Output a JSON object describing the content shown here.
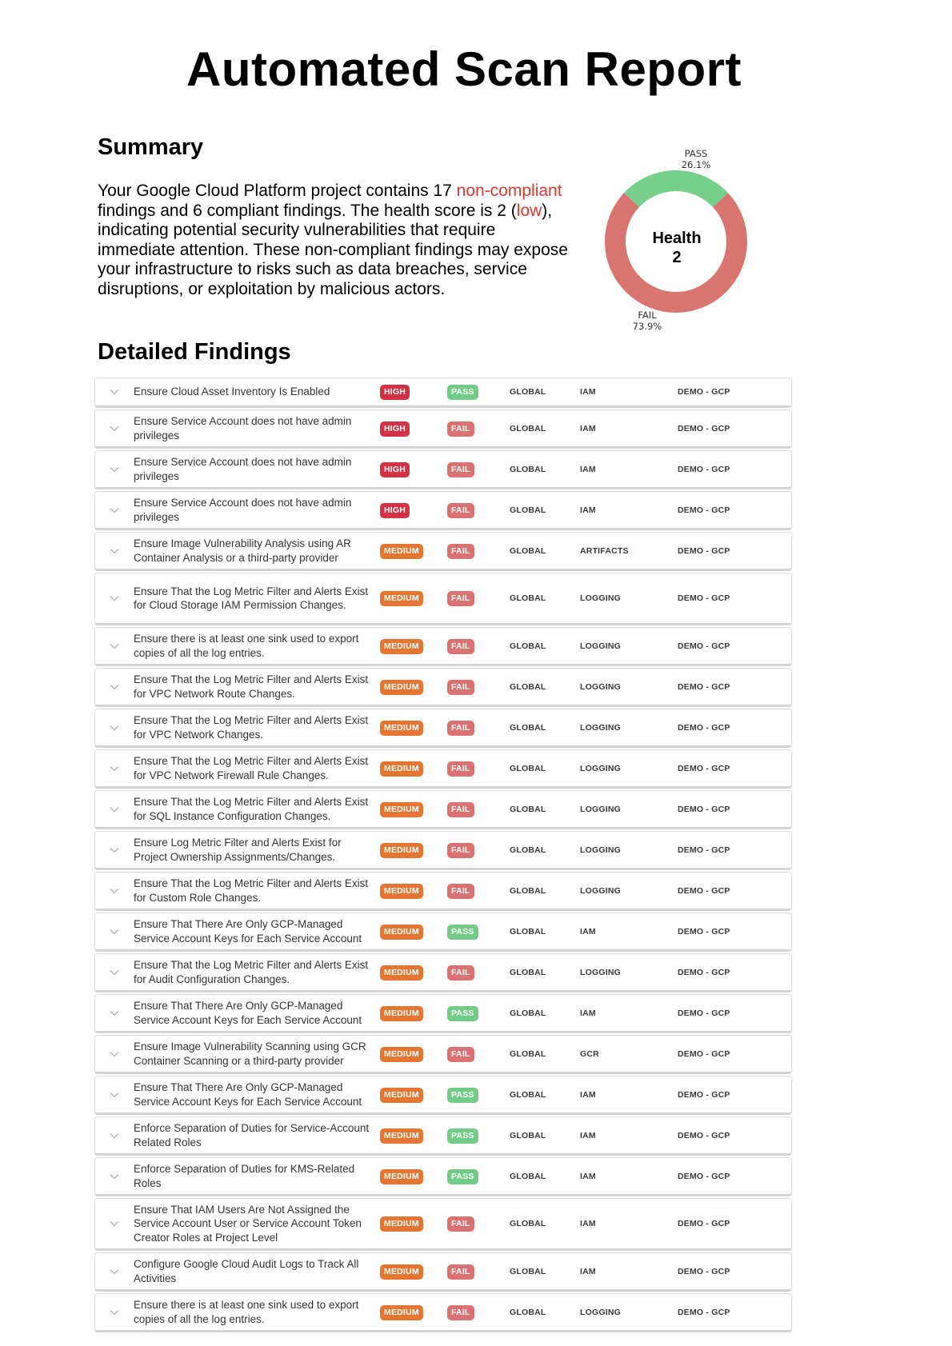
{
  "report": {
    "title": "Automated Scan Report"
  },
  "summary": {
    "heading": "Summary",
    "text_parts": [
      "Your Google Cloud Platform project contains 17 ",
      "non-compliant",
      " findings and 6 compliant findings. The health score is 2 (",
      "low",
      "), indicating potential security vulnerabilities that require immediate attention. These non-compliant findings may expose your infrastructure to risks such as data breaches, service disruptions, or exploitation by malicious actors."
    ],
    "non_compliant_count": 17,
    "compliant_count": 6,
    "health_score": 2,
    "health_rating": "low"
  },
  "chart_data": {
    "type": "pie",
    "donut": true,
    "center_label": [
      "Health",
      "2"
    ],
    "slices": [
      {
        "label": "PASS",
        "value": 26.1,
        "display": "26.1%",
        "color": "#76cf8b"
      },
      {
        "label": "FAIL",
        "value": 73.9,
        "display": "73.9%",
        "color": "#d97570"
      }
    ]
  },
  "findings": {
    "heading": "Detailed Findings",
    "colors": {
      "HIGH": "#d33144",
      "MEDIUM": "#e47632",
      "PASS": "#72cc88",
      "FAIL": "#da7272"
    },
    "rows": [
      {
        "title": "Ensure Cloud Asset Inventory Is Enabled",
        "severity": "HIGH",
        "status": "PASS",
        "region": "GLOBAL",
        "service": "IAM",
        "project": "DEMO - GCP",
        "lines": 1
      },
      {
        "title": "Ensure Service Account does not have admin privileges",
        "severity": "HIGH",
        "status": "FAIL",
        "region": "GLOBAL",
        "service": "IAM",
        "project": "DEMO - GCP",
        "lines": 2
      },
      {
        "title": "Ensure Service Account does not have admin privileges",
        "severity": "HIGH",
        "status": "FAIL",
        "region": "GLOBAL",
        "service": "IAM",
        "project": "DEMO - GCP",
        "lines": 2
      },
      {
        "title": "Ensure Service Account does not have admin privileges",
        "severity": "HIGH",
        "status": "FAIL",
        "region": "GLOBAL",
        "service": "IAM",
        "project": "DEMO - GCP",
        "lines": 2
      },
      {
        "title": "Ensure Image Vulnerability Analysis using AR Container Analysis or a third-party provider",
        "severity": "MEDIUM",
        "status": "FAIL",
        "region": "GLOBAL",
        "service": "ARTIFACTS",
        "project": "DEMO - GCP",
        "lines": 2
      },
      {
        "title": "Ensure That the Log Metric Filter and Alerts Exist for Cloud Storage IAM Permission Changes.",
        "severity": "MEDIUM",
        "status": "FAIL",
        "region": "GLOBAL",
        "service": "LOGGING",
        "project": "DEMO - GCP",
        "lines": 3
      },
      {
        "title": "Ensure there is at least one sink used to export copies of all the log entries.",
        "severity": "MEDIUM",
        "status": "FAIL",
        "region": "GLOBAL",
        "service": "LOGGING",
        "project": "DEMO - GCP",
        "lines": 2
      },
      {
        "title": "Ensure That the Log Metric Filter and Alerts Exist for VPC Network Route Changes.",
        "severity": "MEDIUM",
        "status": "FAIL",
        "region": "GLOBAL",
        "service": "LOGGING",
        "project": "DEMO - GCP",
        "lines": 2
      },
      {
        "title": "Ensure That the Log Metric Filter and Alerts Exist for VPC Network Changes.",
        "severity": "MEDIUM",
        "status": "FAIL",
        "region": "GLOBAL",
        "service": "LOGGING",
        "project": "DEMO - GCP",
        "lines": 2
      },
      {
        "title": "Ensure That the Log Metric Filter and Alerts Exist for VPC Network Firewall Rule Changes.",
        "severity": "MEDIUM",
        "status": "FAIL",
        "region": "GLOBAL",
        "service": "LOGGING",
        "project": "DEMO - GCP",
        "lines": 2
      },
      {
        "title": "Ensure That the Log Metric Filter and Alerts Exist for SQL Instance Configuration Changes.",
        "severity": "MEDIUM",
        "status": "FAIL",
        "region": "GLOBAL",
        "service": "LOGGING",
        "project": "DEMO - GCP",
        "lines": 2
      },
      {
        "title": "Ensure Log Metric Filter and Alerts Exist for Project Ownership Assignments/Changes.",
        "severity": "MEDIUM",
        "status": "FAIL",
        "region": "GLOBAL",
        "service": "LOGGING",
        "project": "DEMO - GCP",
        "lines": 2
      },
      {
        "title": "Ensure That the Log Metric Filter and Alerts Exist for Custom Role Changes.",
        "severity": "MEDIUM",
        "status": "FAIL",
        "region": "GLOBAL",
        "service": "LOGGING",
        "project": "DEMO - GCP",
        "lines": 2
      },
      {
        "title": "Ensure That There Are Only GCP-Managed Service Account Keys for Each Service Account",
        "severity": "MEDIUM",
        "status": "PASS",
        "region": "GLOBAL",
        "service": "IAM",
        "project": "DEMO - GCP",
        "lines": 2
      },
      {
        "title": "Ensure That the Log Metric Filter and Alerts Exist for Audit Configuration Changes.",
        "severity": "MEDIUM",
        "status": "FAIL",
        "region": "GLOBAL",
        "service": "LOGGING",
        "project": "DEMO - GCP",
        "lines": 2
      },
      {
        "title": "Ensure That There Are Only GCP-Managed Service Account Keys for Each Service Account",
        "severity": "MEDIUM",
        "status": "PASS",
        "region": "GLOBAL",
        "service": "IAM",
        "project": "DEMO - GCP",
        "lines": 2
      },
      {
        "title": "Ensure Image Vulnerability Scanning using GCR Container Scanning or a third-party provider",
        "severity": "MEDIUM",
        "status": "FAIL",
        "region": "GLOBAL",
        "service": "GCR",
        "project": "DEMO - GCP",
        "lines": 2
      },
      {
        "title": "Ensure That There Are Only GCP-Managed Service Account Keys for Each Service Account",
        "severity": "MEDIUM",
        "status": "PASS",
        "region": "GLOBAL",
        "service": "IAM",
        "project": "DEMO - GCP",
        "lines": 2
      },
      {
        "title": "Enforce Separation of Duties for Service-Account Related Roles",
        "severity": "MEDIUM",
        "status": "PASS",
        "region": "GLOBAL",
        "service": "IAM",
        "project": "DEMO - GCP",
        "lines": 2
      },
      {
        "title": "Enforce Separation of Duties for KMS-Related Roles",
        "severity": "MEDIUM",
        "status": "PASS",
        "region": "GLOBAL",
        "service": "IAM",
        "project": "DEMO - GCP",
        "lines": 2
      },
      {
        "title": "Ensure That IAM Users Are Not Assigned the Service Account User or Service Account Token Creator Roles at Project Level",
        "severity": "MEDIUM",
        "status": "FAIL",
        "region": "GLOBAL",
        "service": "IAM",
        "project": "DEMO - GCP",
        "lines": 3
      },
      {
        "title": "Configure Google Cloud Audit Logs to Track All Activities",
        "severity": "MEDIUM",
        "status": "FAIL",
        "region": "GLOBAL",
        "service": "IAM",
        "project": "DEMO - GCP",
        "lines": 2
      },
      {
        "title": "Ensure there is at least one sink used to export copies of all the log entries.",
        "severity": "MEDIUM",
        "status": "FAIL",
        "region": "GLOBAL",
        "service": "LOGGING",
        "project": "DEMO - GCP",
        "lines": 2
      }
    ]
  }
}
